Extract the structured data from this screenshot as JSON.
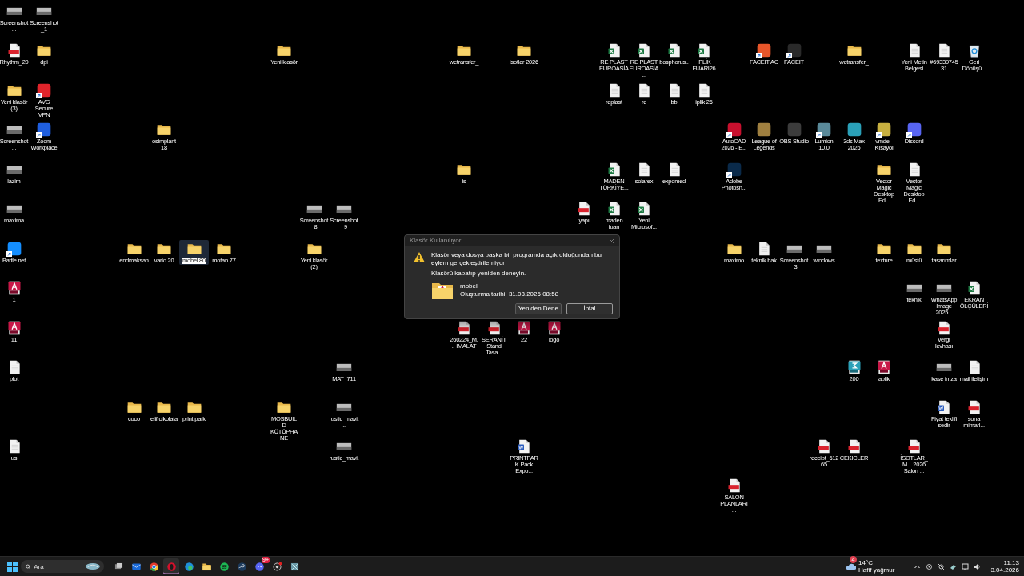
{
  "icons": [
    {
      "label": "Screenshot...",
      "kind": "image",
      "shortcut": false,
      "selected": false
    },
    {
      "label": "Screenshot_1",
      "kind": "image",
      "shortcut": false,
      "selected": false
    },
    {
      "label": "Rhythm_20...",
      "kind": "pdf",
      "shortcut": false,
      "selected": false
    },
    {
      "label": "dpi",
      "kind": "folder",
      "shortcut": false,
      "selected": false
    },
    {
      "label": "Yeni klasör",
      "kind": "folder",
      "shortcut": false,
      "selected": false
    },
    {
      "label": "wetransfer_...",
      "kind": "folder",
      "shortcut": false,
      "selected": false
    },
    {
      "label": "isotlar 2026",
      "kind": "folder",
      "shortcut": false,
      "selected": false
    },
    {
      "label": "RE PLAST EUROASİA",
      "kind": "excel",
      "shortcut": false,
      "selected": false
    },
    {
      "label": "RE PLAST EUROASİA ...",
      "kind": "excel",
      "shortcut": false,
      "selected": false
    },
    {
      "label": "bosphorus...",
      "kind": "excel",
      "shortcut": false,
      "selected": false
    },
    {
      "label": "İPLİK FUARI26",
      "kind": "excel",
      "shortcut": false,
      "selected": false
    },
    {
      "label": "FACEIT AC",
      "kind": "app",
      "color": "#e8562a",
      "shortcut": true,
      "selected": false
    },
    {
      "label": "FACEIT",
      "kind": "app",
      "color": "#2a2a2a",
      "shortcut": true,
      "selected": false
    },
    {
      "label": "wetransfer_...",
      "kind": "folder",
      "shortcut": false,
      "selected": false
    },
    {
      "label": "Yeni Metin Belgesi",
      "kind": "file",
      "shortcut": false,
      "selected": false
    },
    {
      "label": "#6933974531",
      "kind": "file",
      "shortcut": false,
      "selected": false
    },
    {
      "label": "Geri Dönüşü...",
      "kind": "recycle",
      "shortcut": false,
      "selected": false
    },
    {
      "label": "Yeni klasör (3)",
      "kind": "folder",
      "shortcut": false,
      "selected": false
    },
    {
      "label": "AVG Secure VPN",
      "kind": "app",
      "color": "#e0242b",
      "shortcut": true,
      "selected": false
    },
    {
      "label": "replast",
      "kind": "file",
      "shortcut": false,
      "selected": false
    },
    {
      "label": "re",
      "kind": "file",
      "shortcut": false,
      "selected": false
    },
    {
      "label": "bb",
      "kind": "file",
      "shortcut": false,
      "selected": false
    },
    {
      "label": "iplik 26",
      "kind": "file",
      "shortcut": false,
      "selected": false
    },
    {
      "label": "Screenshot...",
      "kind": "image",
      "shortcut": false,
      "selected": false
    },
    {
      "label": "Zoom Workplace",
      "kind": "app",
      "color": "#1f5fe0",
      "shortcut": true,
      "selected": false
    },
    {
      "label": "osimplant 18",
      "kind": "folder",
      "shortcut": false,
      "selected": false
    },
    {
      "label": "AutoCAD 2026 - E...",
      "kind": "app",
      "color": "#c8102e",
      "shortcut": true,
      "selected": false
    },
    {
      "label": "League of Legends",
      "kind": "app",
      "color": "#a08040",
      "shortcut": false,
      "selected": false
    },
    {
      "label": "OBS Studio",
      "kind": "app",
      "color": "#3c3c3c",
      "shortcut": false,
      "selected": false
    },
    {
      "label": "Lumion 10.0",
      "kind": "app",
      "color": "#5a8a9a",
      "shortcut": true,
      "selected": false
    },
    {
      "label": "3ds Max 2026",
      "kind": "app",
      "color": "#2aa0b8",
      "shortcut": false,
      "selected": false
    },
    {
      "label": "vmde - Kısayol",
      "kind": "app",
      "color": "#c8b040",
      "shortcut": true,
      "selected": false
    },
    {
      "label": "Discord",
      "kind": "app",
      "color": "#5865f2",
      "shortcut": true,
      "selected": false
    },
    {
      "label": "lazim",
      "kind": "image",
      "shortcut": false,
      "selected": false
    },
    {
      "label": "is",
      "kind": "folder",
      "shortcut": false,
      "selected": false
    },
    {
      "label": "MADEN TÜRKİYE...",
      "kind": "excel",
      "shortcut": false,
      "selected": false
    },
    {
      "label": "solarex",
      "kind": "file",
      "shortcut": false,
      "selected": false
    },
    {
      "label": "expomed",
      "kind": "file",
      "shortcut": false,
      "selected": false
    },
    {
      "label": "Adobe Photosh...",
      "kind": "app",
      "color": "#0a2a4a",
      "shortcut": true,
      "selected": false
    },
    {
      "label": "Vector Magic Desktop Ed...",
      "kind": "folder",
      "shortcut": false,
      "selected": false
    },
    {
      "label": "Vector Magic Desktop Ed...",
      "kind": "file",
      "shortcut": false,
      "selected": false
    },
    {
      "label": "maxima",
      "kind": "image",
      "shortcut": false,
      "selected": false
    },
    {
      "label": "Screenshot_8",
      "kind": "image",
      "shortcut": false,
      "selected": false
    },
    {
      "label": "Screenshot_9",
      "kind": "image",
      "shortcut": false,
      "selected": false
    },
    {
      "label": "yapı",
      "kind": "pdf",
      "shortcut": false,
      "selected": false
    },
    {
      "label": "maden fuarı",
      "kind": "excel",
      "shortcut": false,
      "selected": false
    },
    {
      "label": "Yeni Microsof...",
      "kind": "excel",
      "shortcut": false,
      "selected": false
    },
    {
      "label": "Battle.net",
      "kind": "app",
      "color": "#148eff",
      "shortcut": true,
      "selected": false
    },
    {
      "label": "endmaksan",
      "kind": "folder",
      "shortcut": false,
      "selected": false
    },
    {
      "label": "vario 20",
      "kind": "folder",
      "shortcut": false,
      "selected": false
    },
    {
      "label": "mobel 80",
      "kind": "folder",
      "shortcut": false,
      "selected": true
    },
    {
      "label": "motan 77",
      "kind": "folder",
      "shortcut": false,
      "selected": false
    },
    {
      "label": "Yeni klasör (2)",
      "kind": "folder",
      "shortcut": false,
      "selected": false
    },
    {
      "label": "maximo",
      "kind": "folder",
      "shortcut": false,
      "selected": false
    },
    {
      "label": "teknik.bak",
      "kind": "file",
      "shortcut": false,
      "selected": false
    },
    {
      "label": "Screenshot_3",
      "kind": "image",
      "shortcut": false,
      "selected": false
    },
    {
      "label": "windows",
      "kind": "image",
      "shortcut": false,
      "selected": false
    },
    {
      "label": "texture",
      "kind": "folder",
      "shortcut": false,
      "selected": false
    },
    {
      "label": "müstü",
      "kind": "folder",
      "shortcut": false,
      "selected": false
    },
    {
      "label": "tasarımlar",
      "kind": "folder",
      "shortcut": false,
      "selected": false
    },
    {
      "label": "1",
      "kind": "fbx",
      "shortcut": false,
      "selected": false
    },
    {
      "label": "teknik",
      "kind": "image",
      "shortcut": false,
      "selected": false
    },
    {
      "label": "WhatsApp Image 2025...",
      "kind": "image",
      "shortcut": false,
      "selected": false
    },
    {
      "label": "EKRAN ÖLÇÜLERİ",
      "kind": "excel",
      "shortcut": false,
      "selected": false
    },
    {
      "label": "11",
      "kind": "fbx",
      "shortcut": false,
      "selected": false
    },
    {
      "label": "260224_M... IMALAT",
      "kind": "pdf",
      "shortcut": false,
      "selected": false
    },
    {
      "label": "SERANİT Stand Tasa...",
      "kind": "pdf",
      "shortcut": false,
      "selected": false
    },
    {
      "label": "22",
      "kind": "fbx",
      "shortcut": false,
      "selected": false
    },
    {
      "label": "logo",
      "kind": "fbx",
      "shortcut": false,
      "selected": false
    },
    {
      "label": "vergi levhası",
      "kind": "pdf",
      "shortcut": false,
      "selected": false
    },
    {
      "label": "plot",
      "kind": "file",
      "shortcut": false,
      "selected": false
    },
    {
      "label": "MAT_711",
      "kind": "image",
      "shortcut": false,
      "selected": false
    },
    {
      "label": "200",
      "kind": "max",
      "shortcut": false,
      "selected": false
    },
    {
      "label": "aplik",
      "kind": "fbx",
      "shortcut": false,
      "selected": false
    },
    {
      "label": "kase imza",
      "kind": "image",
      "shortcut": false,
      "selected": false
    },
    {
      "label": "mail iletişim",
      "kind": "file",
      "shortcut": false,
      "selected": false
    },
    {
      "label": "coco",
      "kind": "folder",
      "shortcut": false,
      "selected": false
    },
    {
      "label": "elif cikolata",
      "kind": "folder",
      "shortcut": false,
      "selected": false
    },
    {
      "label": "print park",
      "kind": "folder",
      "shortcut": false,
      "selected": false
    },
    {
      "label": "MOSBUILD KÜTÜPHANE",
      "kind": "folder",
      "shortcut": false,
      "selected": false
    },
    {
      "label": "rustic_mavi...",
      "kind": "image",
      "shortcut": false,
      "selected": false
    },
    {
      "label": "Fiyat teklifi sedir",
      "kind": "word",
      "shortcut": false,
      "selected": false
    },
    {
      "label": "sona mimarl...",
      "kind": "pdf",
      "shortcut": false,
      "selected": false
    },
    {
      "label": "us",
      "kind": "file",
      "shortcut": false,
      "selected": false
    },
    {
      "label": "rustic_mavi...",
      "kind": "image",
      "shortcut": false,
      "selected": false
    },
    {
      "label": "PRINTPARK Pack Expo...",
      "kind": "word",
      "shortcut": false,
      "selected": false
    },
    {
      "label": "receipt_61265",
      "kind": "pdf",
      "shortcut": false,
      "selected": false
    },
    {
      "label": "CEKICLER",
      "kind": "pdf",
      "shortcut": false,
      "selected": false
    },
    {
      "label": "İSOTLAR_M... 2026 Salon ...",
      "kind": "pdf",
      "shortcut": false,
      "selected": false
    },
    {
      "label": "SALON PLANLARI ...",
      "kind": "pdf",
      "shortcut": false,
      "selected": false
    }
  ],
  "dialog": {
    "title": "Klasör Kullanılıyor",
    "message": "Klasör veya dosya başka bir programda açık olduğundan bu eylem gerçekleştirilemiyor",
    "hint": "Klasörü kapatıp yeniden deneyin.",
    "file_name": "mobel",
    "file_detail": "Oluşturma tarihi: 31.03.2026 08:58",
    "buttons": [
      {
        "label": "Yeniden Dene",
        "selected": false
      },
      {
        "label": "İptal",
        "selected": true
      }
    ]
  },
  "taskbar": {
    "search": {
      "placeholder": "Ara"
    },
    "apps": [
      {
        "kind": "taskview",
        "active": false
      },
      {
        "kind": "mail",
        "active": false
      },
      {
        "kind": "chrome",
        "active": false
      },
      {
        "kind": "opera",
        "active": true
      },
      {
        "kind": "edge",
        "active": false
      },
      {
        "kind": "explorer",
        "active": false
      },
      {
        "kind": "spotify",
        "active": false
      },
      {
        "kind": "steam",
        "active": false
      },
      {
        "kind": "discord",
        "active": false,
        "badge": "9+"
      },
      {
        "kind": "camera",
        "active": false
      },
      {
        "kind": "tool",
        "active": false
      }
    ],
    "weather": {
      "badge": "4",
      "temperature": "14°C",
      "condition": "Hafif yağmur"
    },
    "clock": {
      "time": "11:13",
      "date": "3.04.2026"
    }
  }
}
